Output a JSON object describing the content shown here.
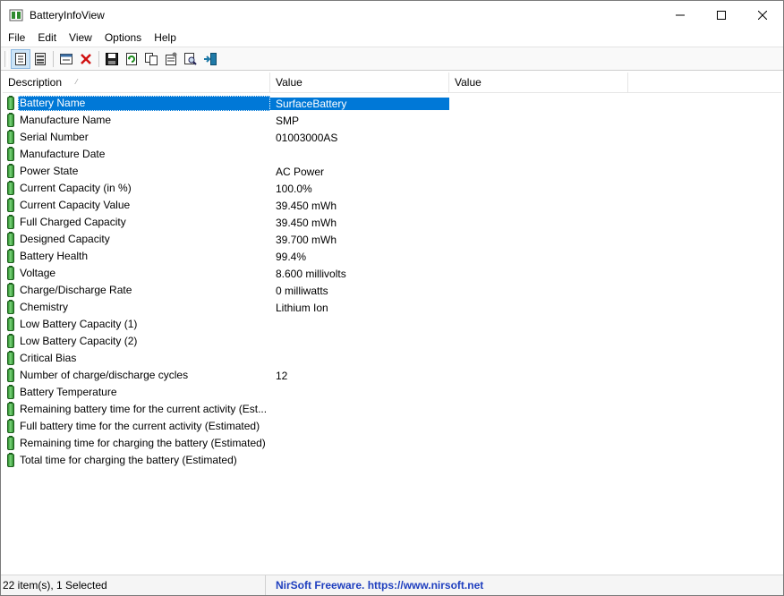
{
  "window": {
    "title": "BatteryInfoView"
  },
  "menu": [
    "File",
    "Edit",
    "View",
    "Options",
    "Help"
  ],
  "toolbar": [
    {
      "icon": "html-report-all-icon"
    },
    {
      "icon": "html-report-selected-icon"
    },
    {
      "icon": "properties-window-icon"
    },
    {
      "icon": "delete-icon"
    },
    {
      "icon": "save-icon"
    },
    {
      "icon": "refresh-icon"
    },
    {
      "icon": "copy-icon"
    },
    {
      "icon": "properties-icon"
    },
    {
      "icon": "find-icon"
    },
    {
      "icon": "exit-icon"
    }
  ],
  "columns": [
    "Description",
    "Value",
    "Value"
  ],
  "rows": [
    {
      "desc": "Battery Name",
      "value": "SurfaceBattery",
      "selected": true
    },
    {
      "desc": "Manufacture Name",
      "value": "SMP"
    },
    {
      "desc": "Serial Number",
      "value": "01003000AS"
    },
    {
      "desc": "Manufacture Date",
      "value": ""
    },
    {
      "desc": "Power State",
      "value": "AC Power"
    },
    {
      "desc": "Current Capacity (in %)",
      "value": "100.0%"
    },
    {
      "desc": "Current Capacity Value",
      "value": "39.450 mWh"
    },
    {
      "desc": "Full Charged Capacity",
      "value": "39.450 mWh"
    },
    {
      "desc": "Designed Capacity",
      "value": "39.700 mWh"
    },
    {
      "desc": "Battery Health",
      "value": "99.4%"
    },
    {
      "desc": "Voltage",
      "value": "8.600 millivolts"
    },
    {
      "desc": "Charge/Discharge Rate",
      "value": "0 milliwatts"
    },
    {
      "desc": "Chemistry",
      "value": "Lithium Ion"
    },
    {
      "desc": "Low Battery Capacity (1)",
      "value": ""
    },
    {
      "desc": "Low Battery Capacity (2)",
      "value": ""
    },
    {
      "desc": "Critical Bias",
      "value": ""
    },
    {
      "desc": "Number of charge/discharge cycles",
      "value": "12"
    },
    {
      "desc": "Battery Temperature",
      "value": ""
    },
    {
      "desc": "Remaining battery time for the current activity (Est...",
      "value": ""
    },
    {
      "desc": "Full battery time for the current activity (Estimated)",
      "value": ""
    },
    {
      "desc": "Remaining time for charging the battery (Estimated)",
      "value": ""
    },
    {
      "desc": "Total  time for charging the battery (Estimated)",
      "value": ""
    }
  ],
  "status": {
    "items": "22 item(s), 1 Selected",
    "credit": "NirSoft Freeware. https://www.nirsoft.net"
  }
}
